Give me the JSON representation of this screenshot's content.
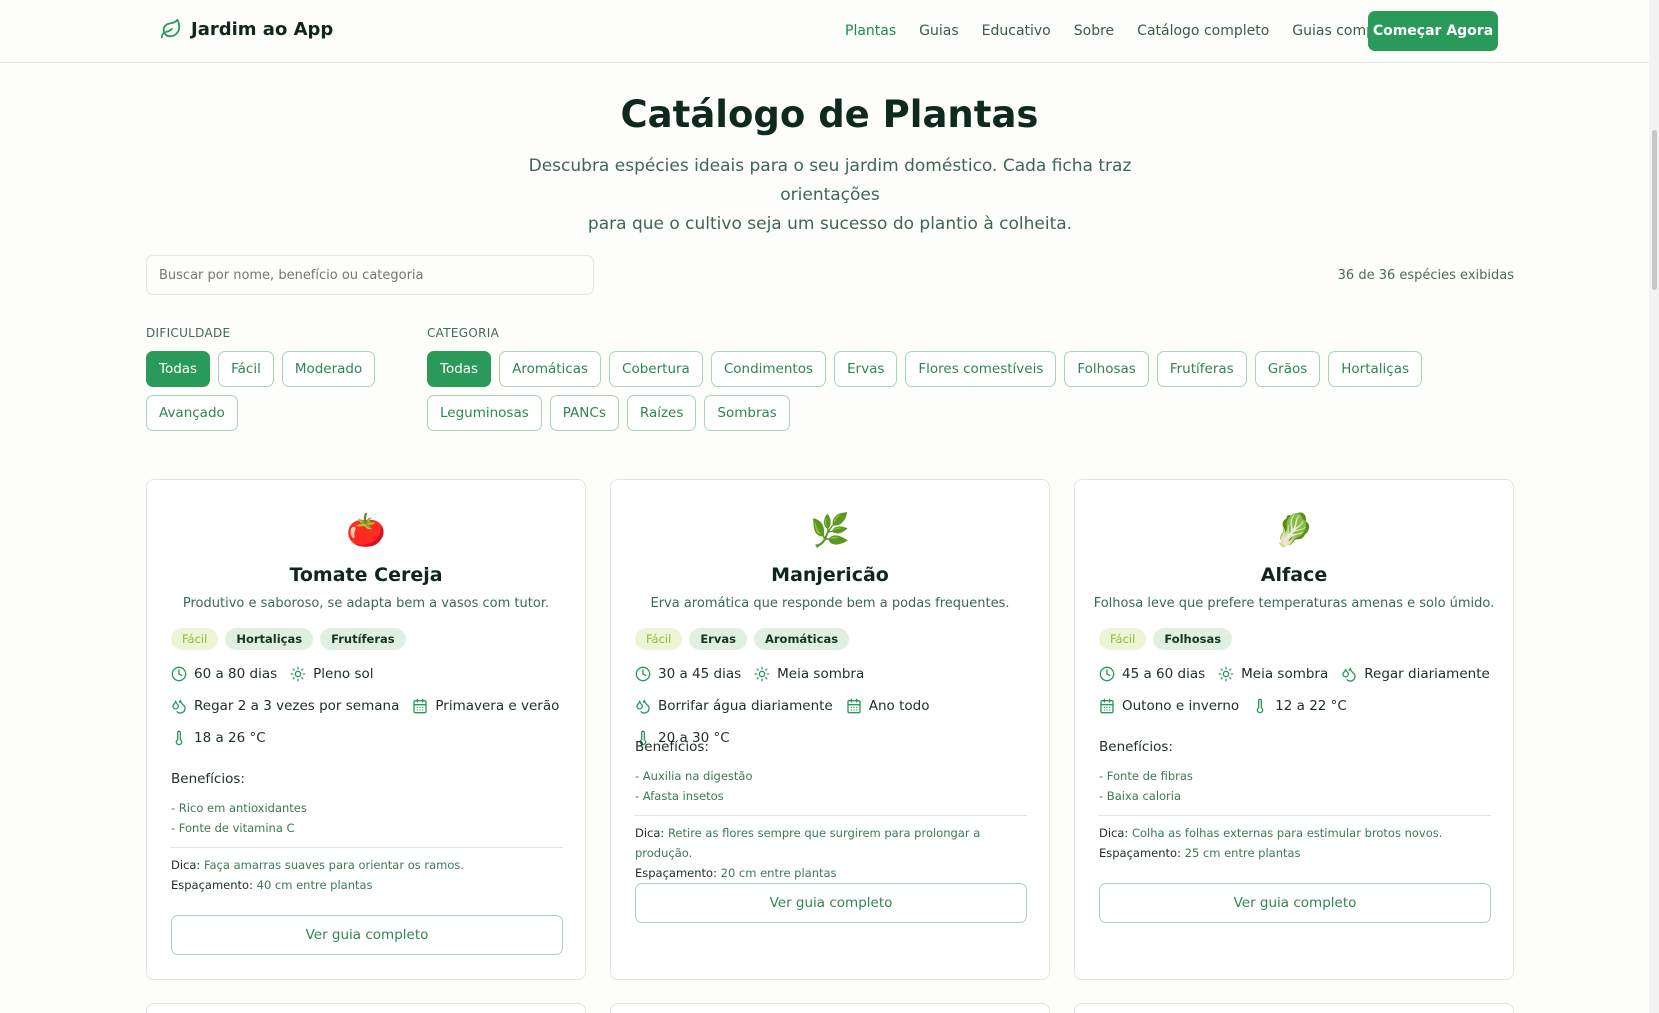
{
  "header": {
    "brand": "Jardim ao App",
    "nav": [
      "Plantas",
      "Guias",
      "Educativo",
      "Sobre",
      "Catálogo completo",
      "Guias completos"
    ],
    "cta": "Começar Agora"
  },
  "hero": {
    "title": "Catálogo de Plantas",
    "subtitle_line1": "Descubra espécies ideais para o seu jardim doméstico. Cada ficha traz orientações",
    "subtitle_line2": "para que o cultivo seja um sucesso do plantio à colheita."
  },
  "search": {
    "placeholder": "Buscar por nome, benefício ou categoria",
    "count": "36 de 36 espécies exibidas"
  },
  "filters": {
    "difficulty_label": "DIFICULDADE",
    "difficulty": [
      "Todas",
      "Fácil",
      "Moderado",
      "Avançado"
    ],
    "category_label": "CATEGORIA",
    "category": [
      "Todas",
      "Aromáticas",
      "Cobertura",
      "Condimentos",
      "Ervas",
      "Flores comestíveis",
      "Folhosas",
      "Frutíferas",
      "Grãos",
      "Hortaliças",
      "Leguminosas",
      "PANCs",
      "Raízes",
      "Sombras"
    ],
    "selected_difficulty": "Todas",
    "selected_category": "Todas"
  },
  "cards": [
    {
      "emoji": "🍅",
      "name": "Tomate Cereja",
      "desc": "Produtivo e saboroso, se adapta bem a vasos com tutor.",
      "level": "Fácil",
      "tags": [
        "Hortaliças",
        "Frutíferas"
      ],
      "cycle": "60 a 80 dias",
      "light": "Pleno sol",
      "water": "Regar 2 a 3 vezes por semana",
      "season": "Primavera e verão",
      "temp": "18 a 26 °C",
      "benefits_title": "Benefícios:",
      "benefits": [
        "- Rico em antioxidantes",
        "- Fonte de vitamina C"
      ],
      "tip_label": "Dica:",
      "tip": "Faça amarras suaves para orientar os ramos.",
      "spacing_label": "Espaçamento:",
      "spacing": "40 cm entre plantas",
      "button": "Ver guia completo"
    },
    {
      "emoji": "🌿",
      "name": "Manjericão",
      "desc": "Erva aromática que responde bem a podas frequentes.",
      "level": "Fácil",
      "tags": [
        "Ervas",
        "Aromáticas"
      ],
      "cycle": "30 a 45 dias",
      "light": "Meia sombra",
      "water": "Borrifar água diariamente",
      "season": "Ano todo",
      "temp": "20 a 30 °C",
      "benefits_title": "Benefícios:",
      "benefits": [
        "- Auxilia na digestão",
        "- Afasta insetos"
      ],
      "tip_label": "Dica:",
      "tip": "Retire as flores sempre que surgirem para prolongar a produção.",
      "spacing_label": "Espaçamento:",
      "spacing": "20 cm entre plantas",
      "button": "Ver guia completo"
    },
    {
      "emoji": "🥬",
      "name": "Alface",
      "desc": "Folhosa leve que prefere temperaturas amenas e solo úmido.",
      "level": "Fácil",
      "tags": [
        "Folhosas"
      ],
      "cycle": "45 a 60 dias",
      "light": "Meia sombra",
      "water": "Regar diariamente",
      "season": "Outono e inverno",
      "temp": "12 a 22 °C",
      "benefits_title": "Benefícios:",
      "benefits": [
        "- Fonte de fibras",
        "- Baixa caloria"
      ],
      "tip_label": "Dica:",
      "tip": "Colha as folhas externas para estimular brotos novos.",
      "spacing_label": "Espaçamento:",
      "spacing": "25 cm entre plantas",
      "button": "Ver guia completo"
    }
  ],
  "colors": {
    "accent": "#2a9a5b",
    "accent_text": "#2e8654",
    "chip_border": "#a9d4b7",
    "tag_bg": "#dff0e3",
    "level_tag_bg": "#eef5d7",
    "level_tag_text": "#8ebd3b",
    "background": "#fdfdfa",
    "heading": "#0d2a1c"
  },
  "icons": {
    "brand": "leaf-icon",
    "cycle": "clock-icon",
    "light": "sun-icon",
    "water": "droplets-icon",
    "season": "calendar-icon",
    "temp": "thermometer-icon"
  }
}
